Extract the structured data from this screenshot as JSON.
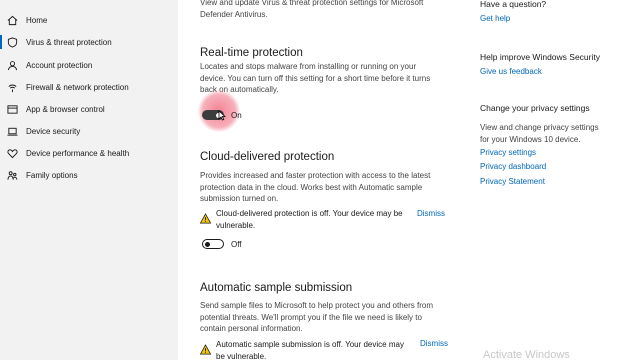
{
  "sidebar": {
    "items": [
      {
        "label": "Home",
        "icon": "home-icon"
      },
      {
        "label": "Virus & threat protection",
        "icon": "shield-icon"
      },
      {
        "label": "Account protection",
        "icon": "person-icon"
      },
      {
        "label": "Firewall & network protection",
        "icon": "wifi-icon"
      },
      {
        "label": "App & browser control",
        "icon": "browser-window-icon"
      },
      {
        "label": "Device security",
        "icon": "laptop-icon"
      },
      {
        "label": "Device performance & health",
        "icon": "heart-icon"
      },
      {
        "label": "Family options",
        "icon": "family-icon"
      }
    ]
  },
  "main": {
    "intro_line1": "View and update Virus & threat protection settings for Microsoft",
    "intro_line2": "Defender Antivirus.",
    "realtime": {
      "title": "Real-time protection",
      "desc1": "Locates and stops malware from installing or running on your",
      "desc2": "device. You can turn off this setting for a short time before it turns",
      "desc3": "back on automatically.",
      "state_label": "On"
    },
    "cloud": {
      "title": "Cloud-delivered protection",
      "desc1": "Provides increased and faster protection with access to the latest",
      "desc2": "protection data in the cloud. Works best with Automatic sample",
      "desc3": "submission turned on.",
      "warning1": "Cloud-delivered protection is off. Your device may be",
      "warning2": "vulnerable.",
      "dismiss": "Dismiss",
      "state_label": "Off"
    },
    "sample": {
      "title": "Automatic sample submission",
      "desc1": "Send sample files to Microsoft to help protect you and others from",
      "desc2": "potential threats. We'll prompt you if the file we need is likely to",
      "desc3": "contain personal information.",
      "warning1": "Automatic sample submission is off. Your device may",
      "warning2": "be vulnerable.",
      "dismiss": "Dismiss"
    }
  },
  "right": {
    "question_heading": "Have a question?",
    "get_help": "Get help",
    "improve_heading": "Help improve Windows Security",
    "feedback": "Give us feedback",
    "privacy_heading": "Change your privacy settings",
    "privacy_text1": "View and change privacy settings",
    "privacy_text2": "for your Windows 10 device.",
    "privacy_settings": "Privacy settings",
    "privacy_dashboard": "Privacy dashboard",
    "privacy_statement": "Privacy Statement"
  },
  "watermark": "Activate Windows",
  "colors": {
    "accent": "#0067c0",
    "link": "#0067b8",
    "cursor_highlight": "#f0808c"
  }
}
